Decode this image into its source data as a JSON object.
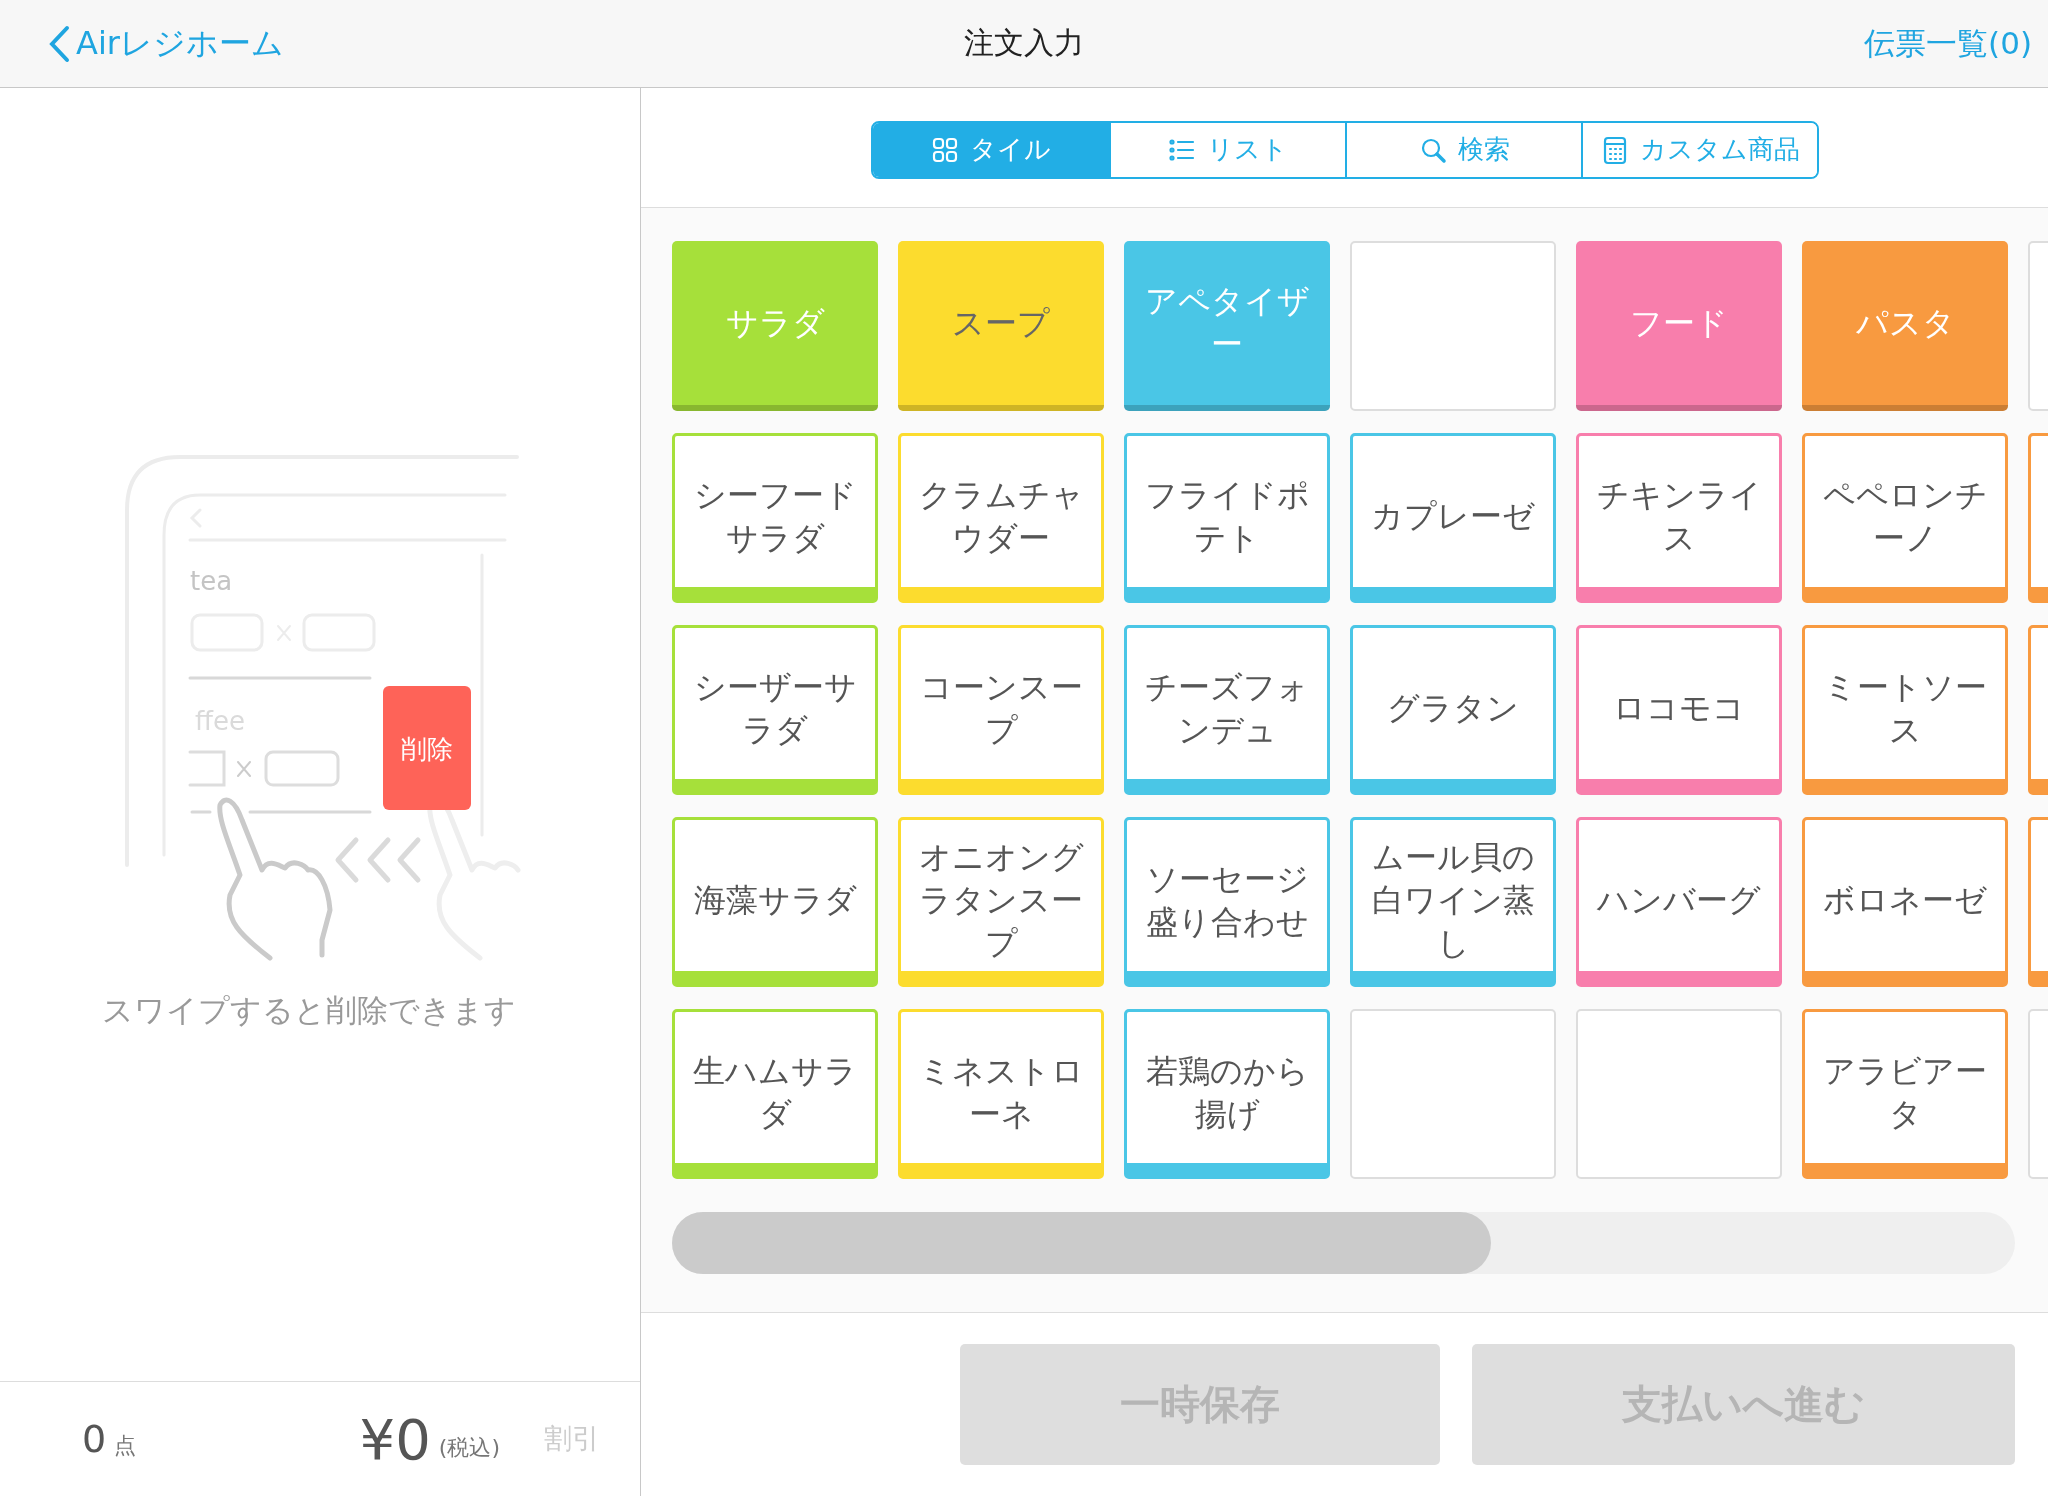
{
  "header": {
    "back_label": "Airレジホーム",
    "title": "注文入力",
    "slips_link": "伝票一覧(0)"
  },
  "view_tabs": [
    {
      "label": "タイル",
      "selected": true
    },
    {
      "label": "リスト",
      "selected": false
    },
    {
      "label": "検索",
      "selected": false
    },
    {
      "label": "カスタム商品",
      "selected": false
    }
  ],
  "illustration": {
    "items": [
      "tea",
      "ffee"
    ],
    "delete_label": "削除",
    "caption": "スワイプすると削除できます"
  },
  "footer": {
    "count": "0",
    "count_unit": "点",
    "total": "¥0",
    "tax_note": "(税込)",
    "discount": "割引",
    "discount_disabled": true
  },
  "tiles": [
    [
      {
        "kind": "category",
        "label": "サラダ",
        "color": "#a6e03a"
      },
      {
        "kind": "category",
        "label": "スープ",
        "color": "#fcdc2e"
      },
      {
        "kind": "category",
        "label": "アペタイザー",
        "color": "#4ac6e6"
      },
      {
        "kind": "empty"
      },
      {
        "kind": "category",
        "label": "フード",
        "color": "#f87eac"
      },
      {
        "kind": "category",
        "label": "パスタ",
        "color": "#f89a40"
      },
      {
        "kind": "empty"
      }
    ],
    [
      {
        "kind": "item",
        "label": "シーフードサラダ",
        "color": "#a6e03a"
      },
      {
        "kind": "item",
        "label": "クラムチャウダー",
        "color": "#fcdc2e"
      },
      {
        "kind": "item",
        "label": "フライドポテト",
        "color": "#4ac6e6"
      },
      {
        "kind": "item",
        "label": "カプレーゼ",
        "color": "#4ac6e6"
      },
      {
        "kind": "item",
        "label": "チキンライス",
        "color": "#f87eac"
      },
      {
        "kind": "item",
        "label": "ペペロンチーノ",
        "color": "#f89a40"
      },
      {
        "kind": "item",
        "color": "#f89a40"
      }
    ],
    [
      {
        "kind": "item",
        "label": "シーザーサラダ",
        "color": "#a6e03a"
      },
      {
        "kind": "item",
        "label": "コーンスープ",
        "color": "#fcdc2e"
      },
      {
        "kind": "item",
        "label": "チーズフォンデュ",
        "color": "#4ac6e6"
      },
      {
        "kind": "item",
        "label": "グラタン",
        "color": "#4ac6e6"
      },
      {
        "kind": "item",
        "label": "ロコモコ",
        "color": "#f87eac"
      },
      {
        "kind": "item",
        "label": "ミートソース",
        "color": "#f89a40"
      },
      {
        "kind": "item",
        "color": "#f89a40"
      }
    ],
    [
      {
        "kind": "item",
        "label": "海藻サラダ",
        "color": "#a6e03a"
      },
      {
        "kind": "item",
        "label": "オニオングラタンスープ",
        "color": "#fcdc2e"
      },
      {
        "kind": "item",
        "label": "ソーセージ盛り合わせ",
        "color": "#4ac6e6"
      },
      {
        "kind": "item",
        "label": "ムール貝の白ワイン蒸し",
        "color": "#4ac6e6"
      },
      {
        "kind": "item",
        "label": "ハンバーグ",
        "color": "#f87eac"
      },
      {
        "kind": "item",
        "label": "ボロネーゼ",
        "color": "#f89a40"
      },
      {
        "kind": "item",
        "color": "#f89a40"
      }
    ],
    [
      {
        "kind": "item",
        "label": "生ハムサラダ",
        "color": "#a6e03a"
      },
      {
        "kind": "item",
        "label": "ミネストローネ",
        "color": "#fcdc2e"
      },
      {
        "kind": "item",
        "label": "若鶏のから揚げ",
        "color": "#4ac6e6"
      },
      {
        "kind": "empty"
      },
      {
        "kind": "empty"
      },
      {
        "kind": "item",
        "label": "アラビアータ",
        "color": "#f89a40"
      },
      {
        "kind": "empty"
      }
    ]
  ],
  "actions": [
    {
      "label": "一時保存",
      "disabled": true
    },
    {
      "label": "支払いへ進む",
      "disabled": true
    }
  ]
}
